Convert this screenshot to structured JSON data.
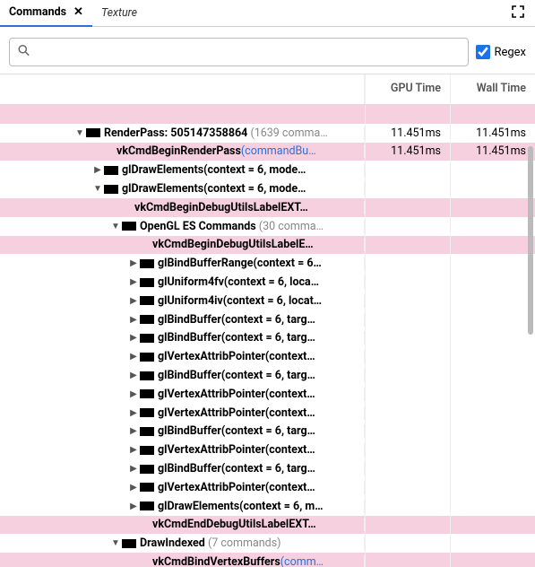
{
  "tabs": {
    "active": "Commands",
    "inactive": "Texture"
  },
  "search": {
    "placeholder": "",
    "value": ""
  },
  "regex_label": "Regex",
  "headers": {
    "gpu": "GPU Time",
    "wall": "Wall Time"
  },
  "rows": [
    {
      "indent": 0,
      "arrow": "",
      "redact": 0,
      "label": "",
      "pink": true,
      "link": "",
      "gpu": "",
      "wall": ""
    },
    {
      "indent": 78,
      "arrow": "down",
      "redact": 16,
      "label": "RenderPass: 505147358864",
      "suffix": " (1639 comma…",
      "pink": false,
      "gpu": "11.451ms",
      "wall": "11.451ms"
    },
    {
      "indent": 112,
      "arrow": "",
      "redact": 0,
      "label": "vkCmdBeginRenderPass",
      "pink": true,
      "link": "(commandBu…",
      "gpu": "11.451ms",
      "wall": "11.451ms"
    },
    {
      "indent": 98,
      "arrow": "right",
      "redact": 16,
      "label": "glDrawElements(context = 6, mode…",
      "pink": false,
      "gpu": "",
      "wall": ""
    },
    {
      "indent": 98,
      "arrow": "down",
      "redact": 16,
      "label": "glDrawElements(context = 6, mode…",
      "pink": false,
      "gpu": "",
      "wall": ""
    },
    {
      "indent": 132,
      "arrow": "",
      "redact": 0,
      "label": "vkCmdBeginDebugUtilsLabelEXT…",
      "pink": true,
      "link": "",
      "gpu": "",
      "wall": ""
    },
    {
      "indent": 118,
      "arrow": "down",
      "redact": 16,
      "label": "OpenGL ES Commands",
      "suffix": " (30 comma…",
      "pink": false,
      "gpu": "",
      "wall": ""
    },
    {
      "indent": 152,
      "arrow": "",
      "redact": 0,
      "label": "vkCmdBeginDebugUtilsLabelE…",
      "pink": true,
      "link": "",
      "gpu": "",
      "wall": ""
    },
    {
      "indent": 138,
      "arrow": "right",
      "redact": 16,
      "label": "glBindBufferRange(context = 6…",
      "pink": false,
      "gpu": "",
      "wall": ""
    },
    {
      "indent": 138,
      "arrow": "right",
      "redact": 16,
      "label": "glUniform4fv(context = 6, loca…",
      "pink": false,
      "gpu": "",
      "wall": ""
    },
    {
      "indent": 138,
      "arrow": "right",
      "redact": 16,
      "label": "glUniform4iv(context = 6, locat…",
      "pink": false,
      "gpu": "",
      "wall": ""
    },
    {
      "indent": 138,
      "arrow": "right",
      "redact": 16,
      "label": "glBindBuffer(context = 6, targ…",
      "pink": false,
      "gpu": "",
      "wall": ""
    },
    {
      "indent": 138,
      "arrow": "right",
      "redact": 16,
      "label": "glBindBuffer(context = 6, targ…",
      "pink": false,
      "gpu": "",
      "wall": ""
    },
    {
      "indent": 138,
      "arrow": "right",
      "redact": 16,
      "label": "glVertexAttribPointer(context…",
      "pink": false,
      "gpu": "",
      "wall": ""
    },
    {
      "indent": 138,
      "arrow": "right",
      "redact": 16,
      "label": "glBindBuffer(context = 6, targ…",
      "pink": false,
      "gpu": "",
      "wall": ""
    },
    {
      "indent": 138,
      "arrow": "right",
      "redact": 16,
      "label": "glVertexAttribPointer(context…",
      "pink": false,
      "gpu": "",
      "wall": ""
    },
    {
      "indent": 138,
      "arrow": "right",
      "redact": 16,
      "label": "glVertexAttribPointer(context…",
      "pink": false,
      "gpu": "",
      "wall": ""
    },
    {
      "indent": 138,
      "arrow": "right",
      "redact": 16,
      "label": "glBindBuffer(context = 6, targ…",
      "pink": false,
      "gpu": "",
      "wall": ""
    },
    {
      "indent": 138,
      "arrow": "right",
      "redact": 16,
      "label": "glVertexAttribPointer(context…",
      "pink": false,
      "gpu": "",
      "wall": ""
    },
    {
      "indent": 138,
      "arrow": "right",
      "redact": 16,
      "label": "glBindBuffer(context = 6, targ…",
      "pink": false,
      "gpu": "",
      "wall": ""
    },
    {
      "indent": 138,
      "arrow": "right",
      "redact": 16,
      "label": "glVertexAttribPointer(context…",
      "pink": false,
      "gpu": "",
      "wall": ""
    },
    {
      "indent": 138,
      "arrow": "right",
      "redact": 16,
      "label": "glDrawElements(context = 6, m…",
      "pink": false,
      "gpu": "",
      "wall": ""
    },
    {
      "indent": 152,
      "arrow": "",
      "redact": 0,
      "label": "vkCmdEndDebugUtilsLabelEXT…",
      "pink": true,
      "link": "",
      "gpu": "",
      "wall": ""
    },
    {
      "indent": 118,
      "arrow": "down",
      "redact": 16,
      "label": "DrawIndexed",
      "suffix": " (7 commands)",
      "pink": false,
      "gpu": "",
      "wall": ""
    },
    {
      "indent": 152,
      "arrow": "",
      "redact": 0,
      "label": "vkCmdBindVertexBuffers",
      "pink": true,
      "link": "(comm…",
      "gpu": "",
      "wall": ""
    }
  ]
}
